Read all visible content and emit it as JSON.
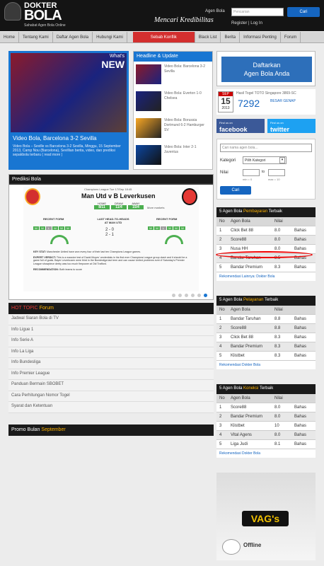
{
  "header": {
    "logo_top": "DOKTER",
    "logo_main": "BOLA",
    "logo_sub": "Sahabat Agen Bola Online",
    "motto": "Mencari Kredibilitas",
    "agent_label": "Agen Bola",
    "agent_placeholder": "Pencarian",
    "search_button": "Cari",
    "register": "Register",
    "sep": "|",
    "login": "Log In"
  },
  "nav": {
    "items": [
      "Home",
      "Tentang Kami",
      "Daftar Agen Bola",
      "Hubungi Kami"
    ],
    "active": "Sebab Konflik",
    "items_right": [
      "Black List",
      "Berita",
      "Informasi Penting",
      "Forum"
    ]
  },
  "hero": {
    "badge_what": "What's",
    "badge_new": "NEW",
    "title": "Video Bola, Barcelona 3-2 Sevilla",
    "desc": "Video Bola – Seville vs Barcelona 3-2 Sevilla, Minggu, 15 September 2013, Camp Nou (Barcelona), Sevillian berita, video, dan prediksi sepakbola terbaru ( read more )"
  },
  "headlines": {
    "title": "Headline & Update",
    "items": [
      "Video Bola: Barcelona 3-2 Sevilla",
      "Video Bola: Everton 1-0 Chelsea",
      "Video Bola: Borussia Dortmund 6-2 Hamburger SV",
      "Video Bola: Inter 2-1 Juventus"
    ]
  },
  "prediction": {
    "title": "Prediksi Bola",
    "competition": "Champions League",
    "date": "Tue 17/Sep 18:45",
    "match": "Man Utd v B Leverkusen",
    "odds_labels": [
      "HOME",
      "DRAW",
      "AWAY"
    ],
    "odds": [
      "8/11",
      "11/4",
      "15/4"
    ],
    "more": "More markets",
    "form_title": "RECENT FORM",
    "h2h_title": "LAST HEAD-TO-HEADS AT MAN UTD",
    "h2h": [
      "2 - 0",
      "2 - 1"
    ],
    "form_home": [
      "W",
      "W",
      "L",
      "W",
      "W",
      "W"
    ],
    "form_away": [
      "W",
      "W",
      "L",
      "W",
      "W",
      "W"
    ],
    "key_stat_label": "KEY STAT:",
    "key_stat": "Manchester United have won every four of their last ten Champions League games.",
    "verdict_label": "EXPERT VERDICT:",
    "verdict": "This is a massive test of David Moyes' credentials in his first ever Champions League group clash and it should be a game full of goals. Bayer Leverkusen were third in the Bundesliga last term and can cause United problems even if Saturday's Premier League showpiece derby was too much firepower at Old Trafford.",
    "rec_label": "RECOMMENDATION:",
    "rec": "Both teams to score"
  },
  "forum": {
    "hot": "HOT TOPIC",
    "forum_word": "Forum",
    "items": [
      "Jadwal Siaran Bola di TV",
      "Info Ligue 1",
      "Info Serie A",
      "Info La Liga",
      "Info Bundesliga",
      "Info Premier League",
      "Panduan Bermain SBOBET",
      "Cara Perhitungan Nomor Togel",
      "Syarat dan Ketentuan"
    ]
  },
  "promo": {
    "label": "Promo Bulan",
    "month": "September"
  },
  "daftar": {
    "line1": "Daftarkan",
    "line2": "Agen Bola Anda"
  },
  "toto": {
    "month": "SEP",
    "day": "15",
    "year": "2013",
    "heading": "Hasil Togel TOTO Singapore 3869-SC",
    "number": "7292",
    "kind": "BESAR GENAP"
  },
  "social": {
    "fb_top": "Find us on",
    "fb": "facebook",
    "tw_top": "Find us on",
    "tw": "twitter"
  },
  "search_box": {
    "placeholder": "Cari nama agen bola...",
    "kategori_label": "Kategori",
    "kategori_value": "Pilih Kategori",
    "nilai_label": "Nilai",
    "to": "to",
    "min_hint": "min = 0",
    "max_hint": "max = 10",
    "button": "Cari"
  },
  "pembayaran": {
    "title_pre": "5 Agen Bola",
    "title_hl": "Pembayaran",
    "title_post": "Terbaik",
    "head": [
      "No",
      "Agen Bola",
      "Nilai",
      ""
    ],
    "rows": [
      [
        "1",
        "Click Bet 88",
        "8.0",
        "Bahas"
      ],
      [
        "2",
        "Score88",
        "8.0",
        "Bahas"
      ],
      [
        "3",
        "Nusa HH",
        "8.0",
        "Bahas"
      ],
      [
        "4",
        "Bandar Taruhan",
        "8.5",
        "Bahas"
      ],
      [
        "5",
        "Bandar Premium",
        "8.3",
        "Bahas"
      ]
    ],
    "rek": "Rekomendasi Lainnya: Dokter Bola"
  },
  "pelayanan": {
    "title_pre": "5 Agen Bola",
    "title_hl": "Pelayanan",
    "title_post": "Terbaik",
    "head": [
      "No",
      "Agen Bola",
      "Nilai",
      ""
    ],
    "rows": [
      [
        "1",
        "Bandar Taruhan",
        "8.8",
        "Bahas"
      ],
      [
        "2",
        "Score88",
        "8.8",
        "Bahas"
      ],
      [
        "3",
        "Click Bet 88",
        "8.3",
        "Bahas"
      ],
      [
        "4",
        "Bandar Premium",
        "8.3",
        "Bahas"
      ],
      [
        "5",
        "Klistbet",
        "8.3",
        "Bahas"
      ]
    ],
    "rek": "Rekomendasi Dokter Bola"
  },
  "koneksi": {
    "title_pre": "5 Agen Bola",
    "title_hl": "Koneksi",
    "title_post": "Terbaik",
    "head": [
      "No",
      "Agen Bola",
      "Nilai",
      ""
    ],
    "rows": [
      [
        "1",
        "Score88",
        "8.0",
        "Bahas"
      ],
      [
        "2",
        "Bandar Premium",
        "8.0",
        "Bahas"
      ],
      [
        "3",
        "Klistbet",
        "10",
        "Bahas"
      ],
      [
        "4",
        "Vital Agens",
        "8.0",
        "Bahas"
      ],
      [
        "5",
        "Liga Judi",
        "8.1",
        "Bahas"
      ]
    ],
    "rek": "Rekomendasi Dokter Bola"
  },
  "ad": {
    "logo": "VAG's",
    "status": "Offline"
  }
}
